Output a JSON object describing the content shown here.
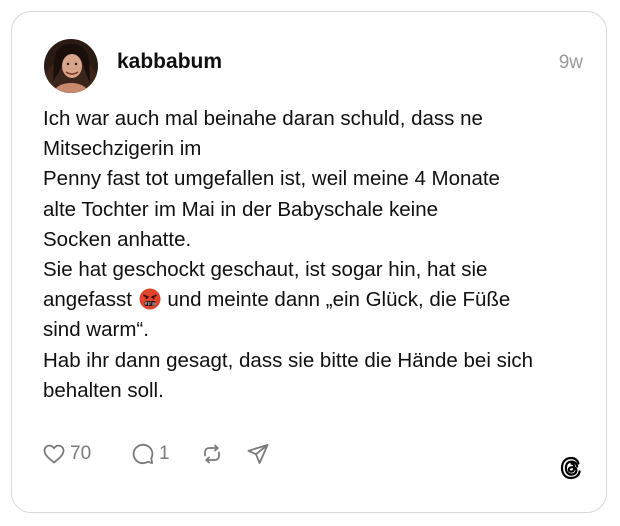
{
  "post": {
    "username": "kabbabum",
    "timestamp": "9w",
    "avatar_icon": "profile-photo",
    "text_lines": [
      "Ich war auch mal beinahe daran schuld, dass ne",
      "Mitsechzigerin im",
      "Penny fast tot umgefallen ist, weil meine 4 Monate",
      "alte Tochter im Mai in der Babyschale keine",
      "Socken anhatte.",
      "Sie hat geschockt geschaut, ist sogar hin, hat sie",
      "angefasst",
      "und meinte dann „ein Glück, die Füße",
      "sind warm“.",
      "Hab ihr dann gesagt, dass sie bitte die Hände bei sich",
      "behalten soll."
    ],
    "emoji": "face-with-symbols-on-mouth"
  },
  "actions": {
    "like_icon": "heart-icon",
    "like_count": "70",
    "reply_icon": "comment-icon",
    "reply_count": "1",
    "repost_icon": "repost-icon",
    "share_icon": "send-icon"
  },
  "brand": {
    "logo": "threads-logo"
  },
  "colors": {
    "text": "#101010",
    "secondary": "#9a9a9a",
    "icon": "#7a7a7a",
    "border": "#d9d9d9",
    "emoji_face": "#e0452c"
  }
}
